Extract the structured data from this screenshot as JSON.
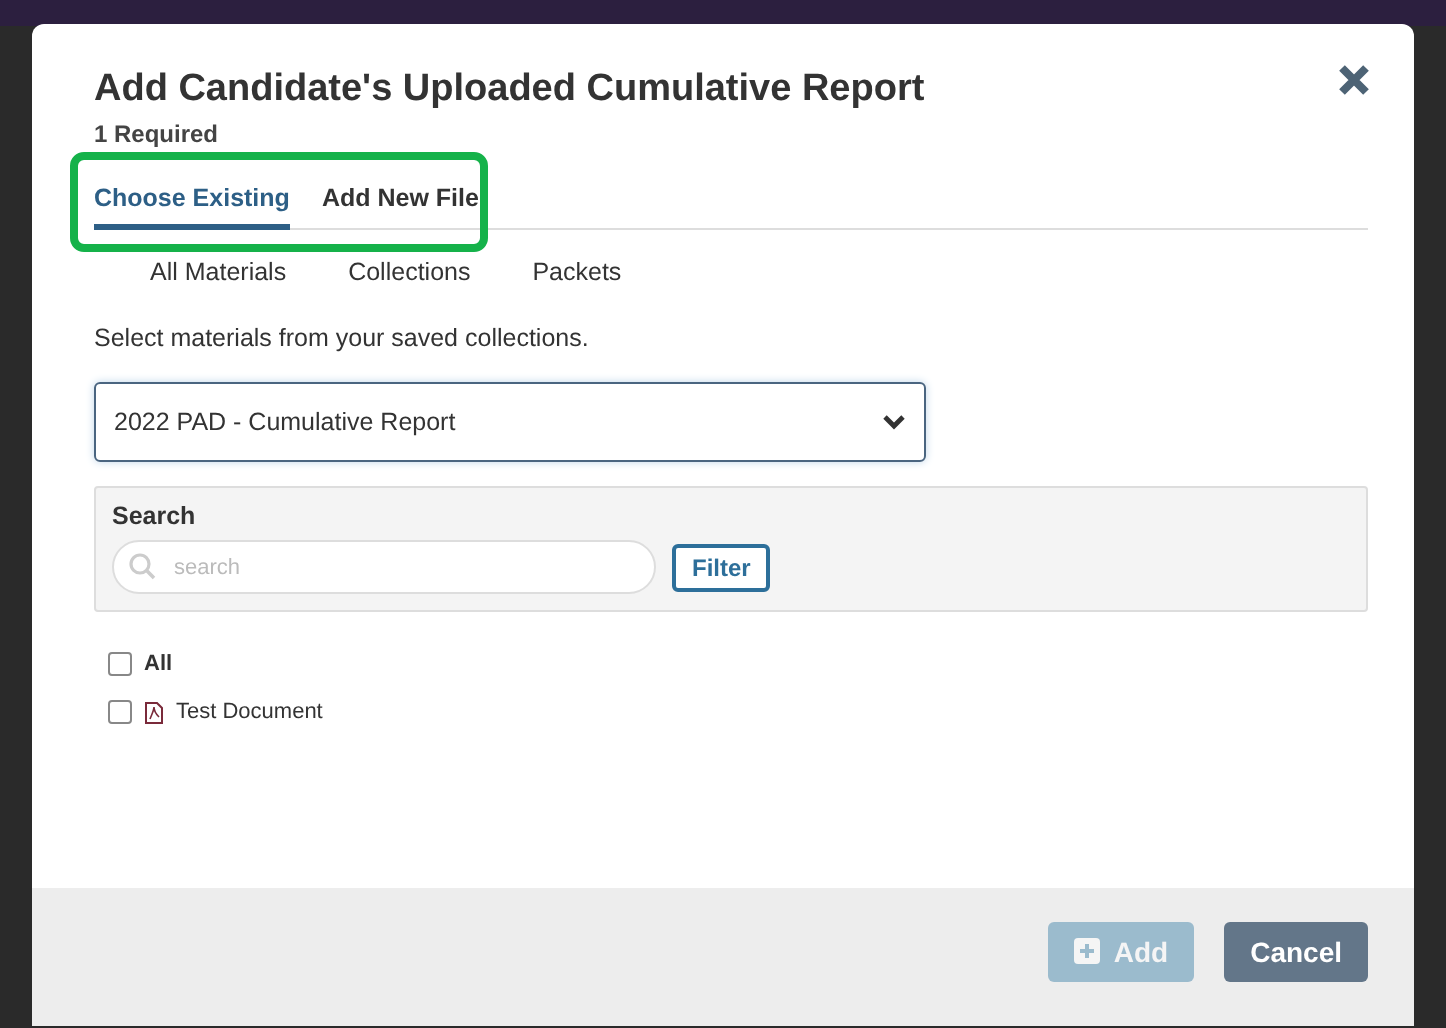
{
  "dialog": {
    "title": "Add Candidate's Uploaded Cumulative Report",
    "subtitle": "1 Required"
  },
  "tabs": [
    {
      "label": "Choose Existing",
      "selected": true
    },
    {
      "label": "Add New File",
      "selected": false
    }
  ],
  "subtabs": [
    {
      "label": "All Materials"
    },
    {
      "label": "Collections"
    },
    {
      "label": "Packets"
    }
  ],
  "instructions": "Select materials from your saved collections.",
  "collection_select": {
    "value": "2022 PAD - Cumulative Report"
  },
  "search": {
    "label": "Search",
    "placeholder": "search",
    "filter_button": "Filter"
  },
  "items": [
    {
      "kind": "all",
      "label": "All",
      "checked": false
    },
    {
      "kind": "document",
      "label": "Test Document",
      "checked": false
    }
  ],
  "buttons": [
    {
      "kind": "add",
      "label": "Add",
      "disabled": true
    },
    {
      "kind": "cancel",
      "label": "Cancel",
      "disabled": false
    }
  ]
}
